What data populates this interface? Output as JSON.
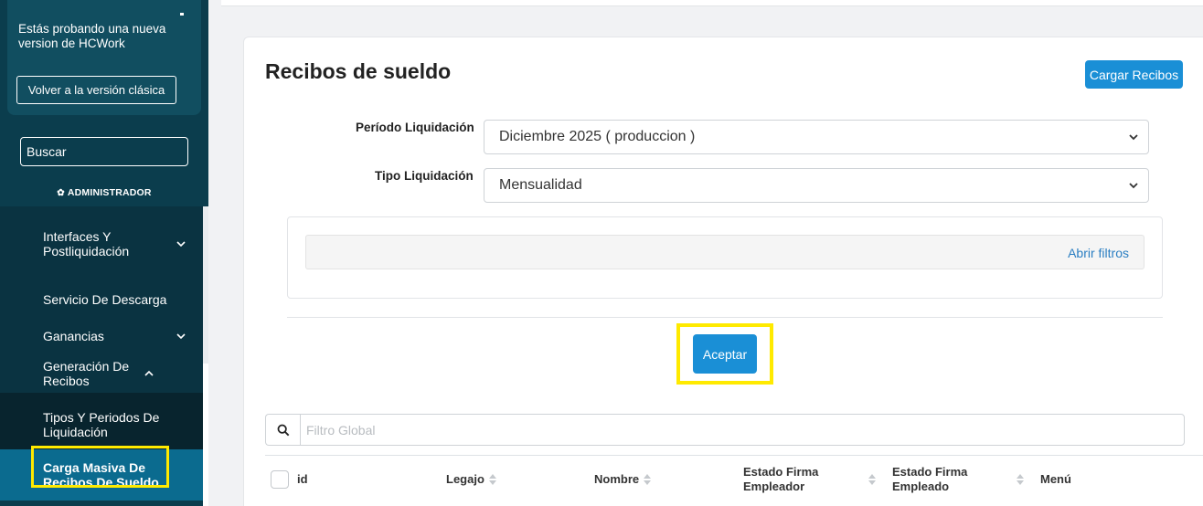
{
  "sidebar": {
    "promo_text": "Estás probando una nueva version de HCWork",
    "classic_button": "Volver a la versión clásica",
    "search_placeholder": "Buscar",
    "role_label": "ADMINISTRADOR",
    "items": [
      {
        "label": "Interfaces Y Postliquidación",
        "chevron": "down"
      },
      {
        "label": "Servicio De Descarga"
      },
      {
        "label": "Ganancias",
        "chevron": "down"
      },
      {
        "label": "Generación De Recibos",
        "chevron": "up"
      }
    ],
    "sub_items": [
      {
        "label": "Tipos Y Periodos De Liquidación"
      },
      {
        "label": "Carga Masiva De Recibos De Sueldo",
        "active": true
      }
    ]
  },
  "main": {
    "title": "Recibos de sueldo",
    "upload_button": "Cargar Recibos",
    "periodo_label": "Período Liquidación",
    "periodo_value": "Diciembre 2025 ( produccion )",
    "tipo_label": "Tipo Liquidación",
    "tipo_value": "Mensualidad",
    "open_filters": "Abrir filtros",
    "accept_button": "Aceptar",
    "global_filter_placeholder": "Filtro Global",
    "table": {
      "columns": [
        "id",
        "Legajo",
        "Nombre",
        "Estado Firma Empleador",
        "Estado Firma Empleado",
        "Menú"
      ]
    }
  },
  "colors": {
    "sidebar_bg": "#0b3d4d",
    "active_item": "#0b6b8f",
    "primary": "#1a8fd6",
    "highlight": "#ffea00"
  }
}
